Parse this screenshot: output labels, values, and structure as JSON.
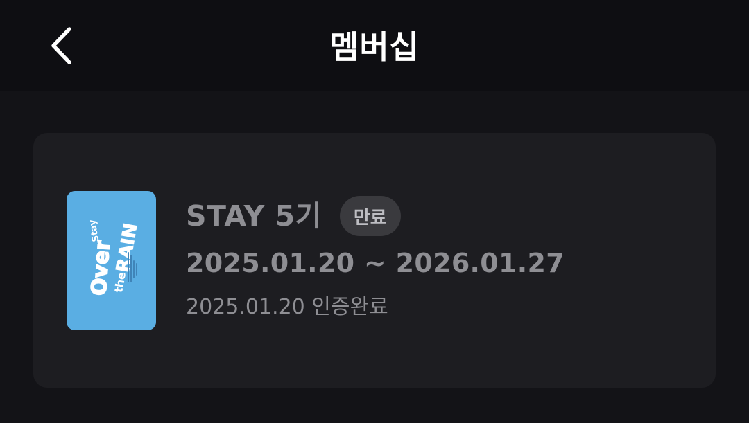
{
  "header": {
    "title": "멤버십",
    "back_icon": "chevron-left-icon"
  },
  "membership": {
    "name": "STAY 5기",
    "status": "만료",
    "period": "2025.01.20 ~ 2026.01.27",
    "verified": "2025.01.20 인증완료",
    "card_image": {
      "background": "#5aaee3",
      "lettering": "Over the RAIN STAY"
    }
  },
  "colors": {
    "background": "#131317",
    "header_background": "#0e0e12",
    "card_background": "#1d1d21",
    "badge_background": "#3a3a3e",
    "muted_text": "#8e8e93"
  }
}
